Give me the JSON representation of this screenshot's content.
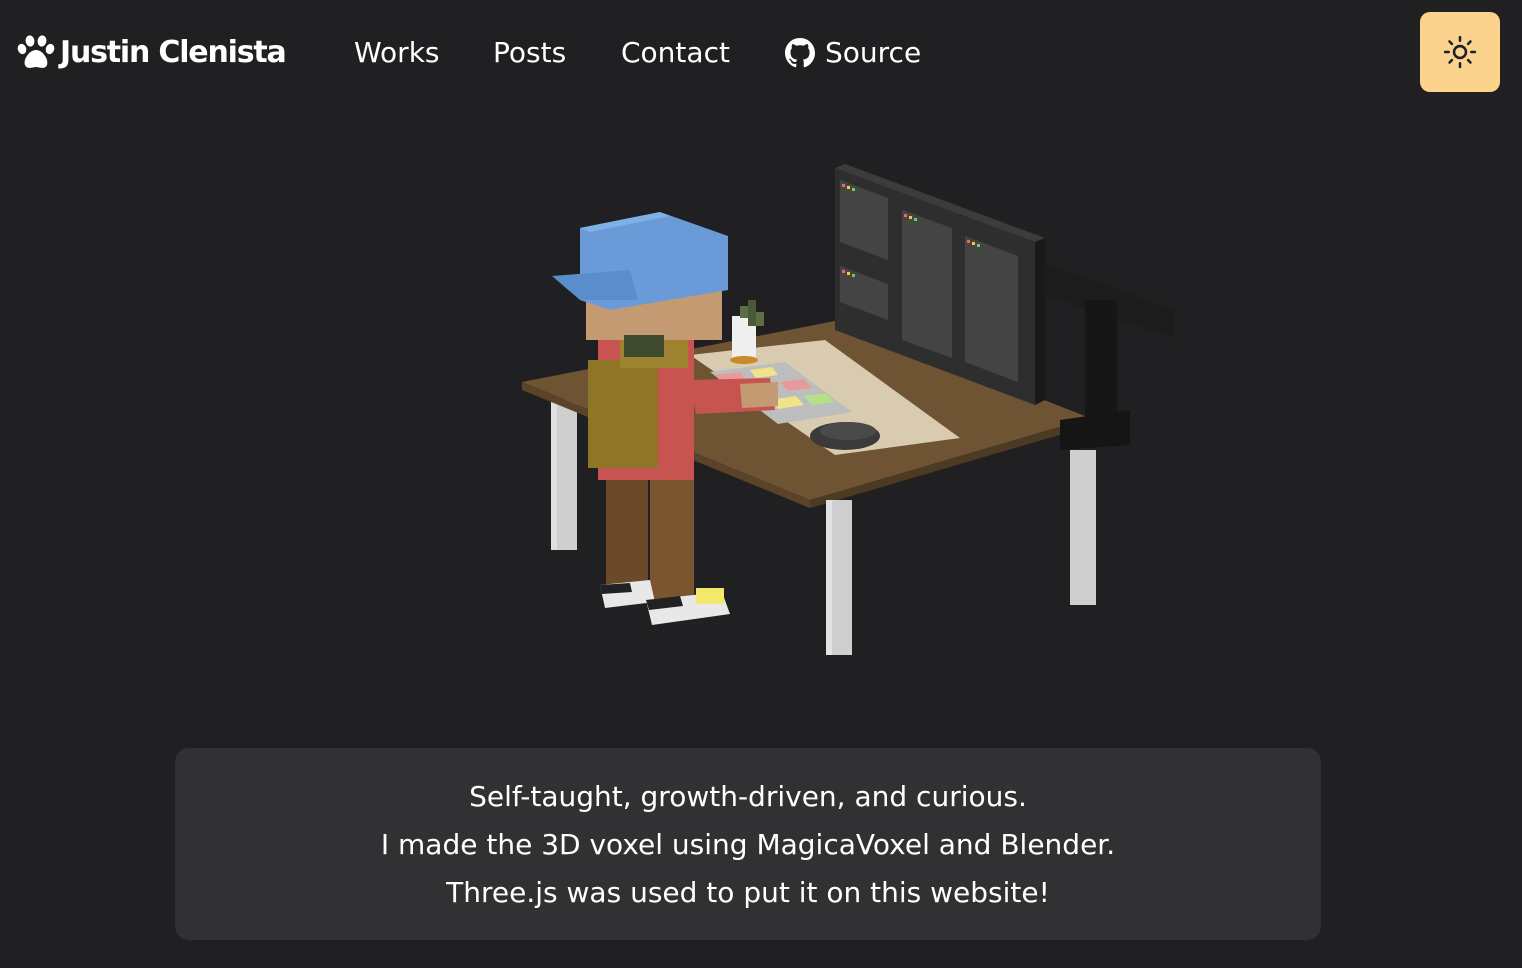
{
  "header": {
    "brand_name": "Justin Clenista",
    "brand_icon": "paw-icon",
    "nav": {
      "works": "Works",
      "posts": "Posts",
      "contact": "Contact",
      "source": "Source"
    },
    "source_icon": "github-icon",
    "theme_toggle_icon": "sun-icon"
  },
  "hero": {
    "scene": "voxel-character-at-desk"
  },
  "intro": {
    "lines": [
      "Self-taught, growth-driven, and curious.",
      "I made the 3D voxel using MagicaVoxel and Blender.",
      "Three.js was used to put it on this website!"
    ]
  },
  "colors": {
    "background": "#202023",
    "card": "#313134",
    "toggle": "#fbd38d",
    "text": "#ffffff"
  }
}
